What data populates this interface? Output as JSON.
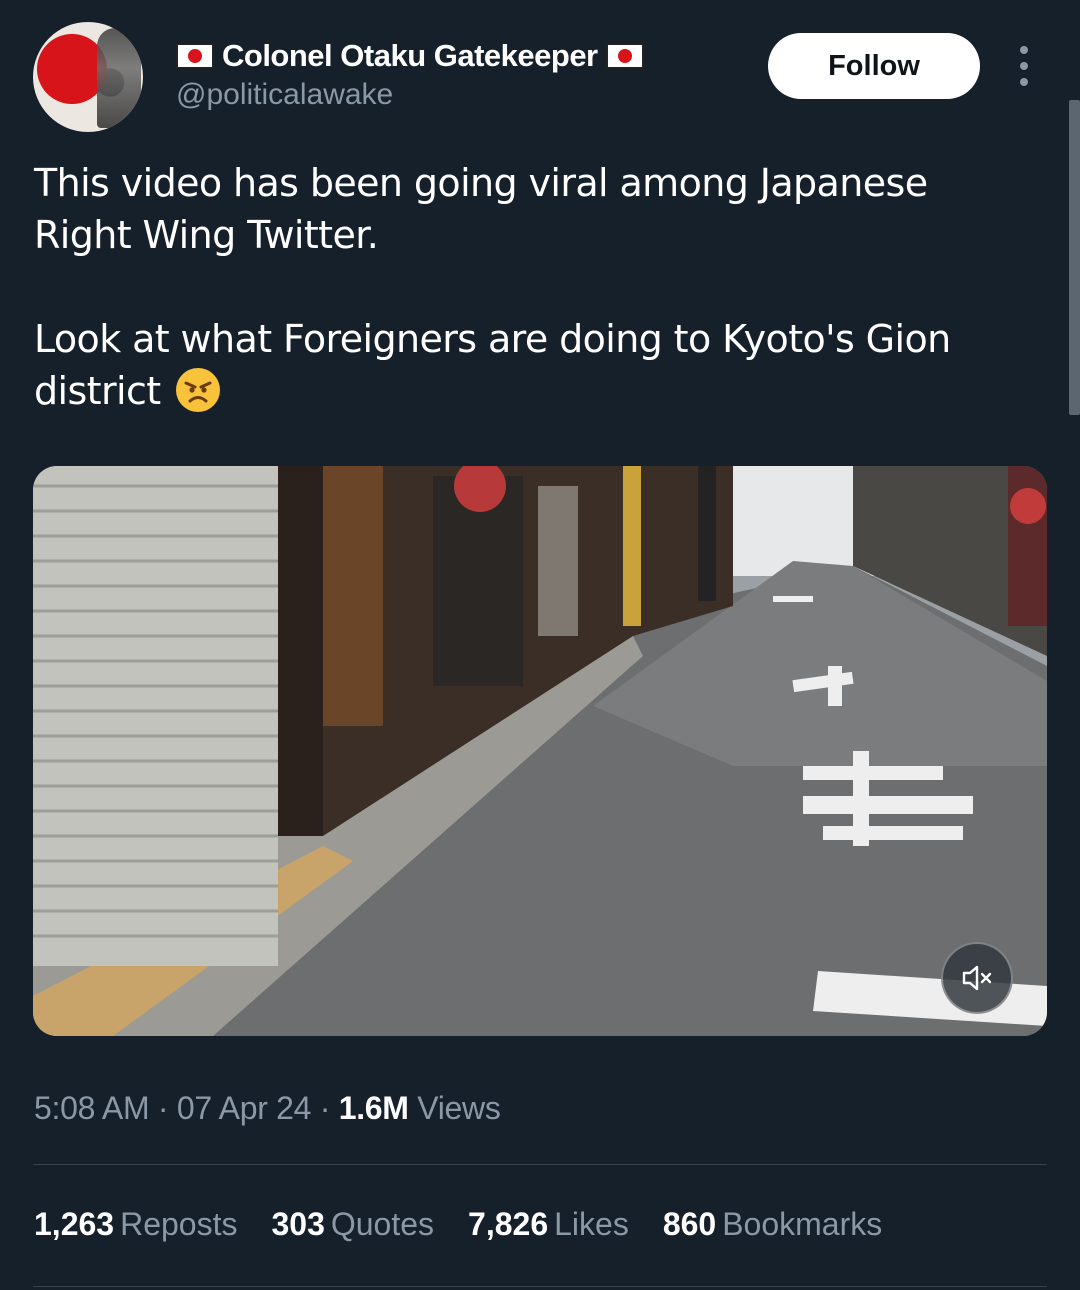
{
  "author": {
    "name": "Colonel Otaku Gatekeeper",
    "handle": "@politicalawake"
  },
  "follow_label": "Follow",
  "tweet": {
    "paragraph1": "This video has been going viral among Japanese Right Wing Twitter.",
    "paragraph2": "Look at what Foreigners are doing to Kyoto's Gion district",
    "emoji": "angry-face"
  },
  "meta": {
    "time": "5:08 AM",
    "date": "07 Apr 24",
    "views_count": "1.6M",
    "views_label": "Views",
    "separator": "·"
  },
  "stats": [
    {
      "count": "1,263",
      "label": "Reposts"
    },
    {
      "count": "303",
      "label": "Quotes"
    },
    {
      "count": "7,826",
      "label": "Likes"
    },
    {
      "count": "860",
      "label": "Bookmarks"
    }
  ],
  "icons": {
    "flag": "japan-flag-icon",
    "more": "more-options-icon",
    "mute": "speaker-muted-icon"
  },
  "colors": {
    "background": "#15202b",
    "secondary_text": "#8b98a5",
    "divider": "#38444d",
    "follow_bg": "#ffffff"
  }
}
